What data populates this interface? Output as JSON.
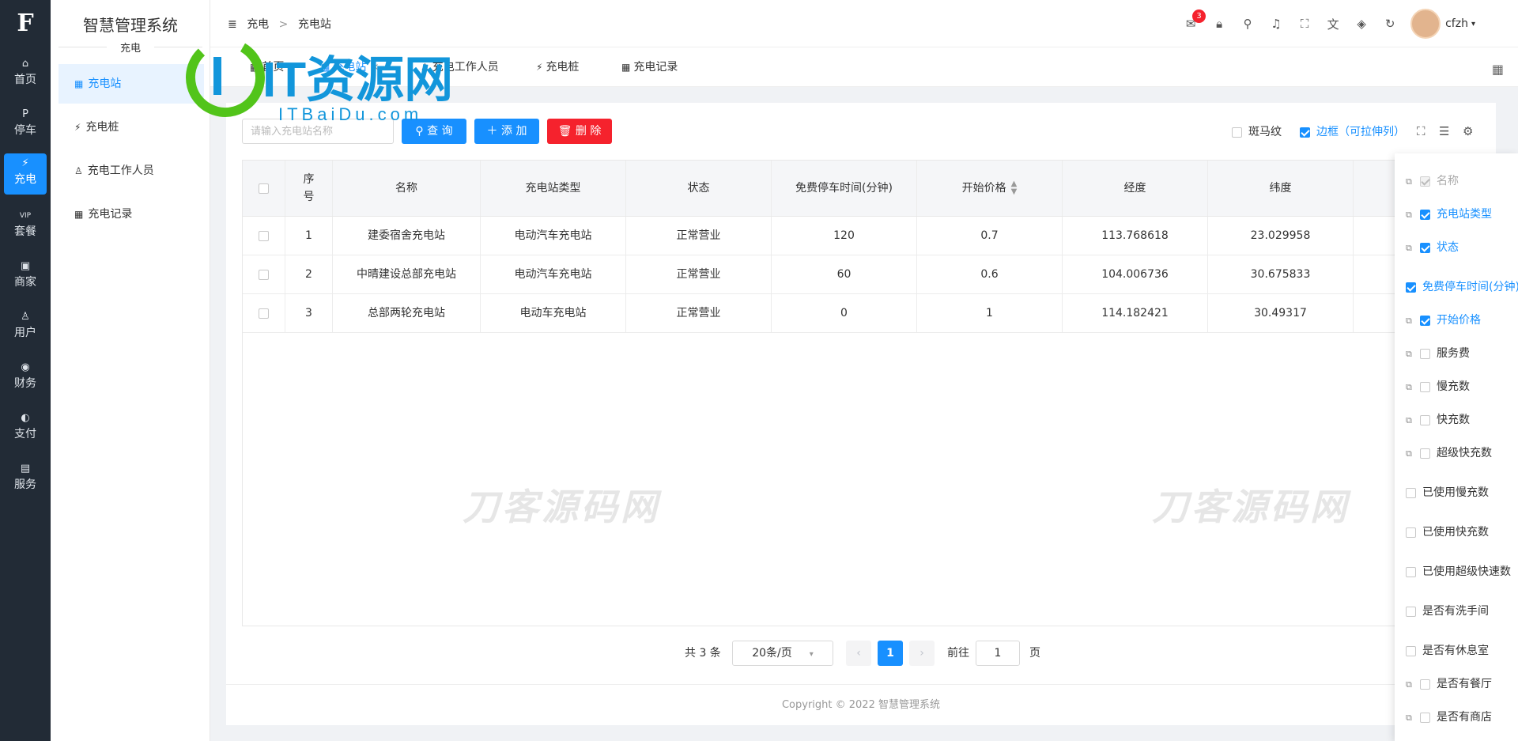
{
  "rail": {
    "logo": "F",
    "items": [
      {
        "label": "首页",
        "icon": "home-icon",
        "glyph": "⌂"
      },
      {
        "label": "停车",
        "icon": "parking-icon",
        "glyph": "P"
      },
      {
        "label": "充电",
        "icon": "charging-icon",
        "glyph": "⚡"
      },
      {
        "label": "套餐",
        "icon": "vip-icon",
        "glyph": "VIP"
      },
      {
        "label": "商家",
        "icon": "shop-icon",
        "glyph": "▣"
      },
      {
        "label": "用户",
        "icon": "user-icon",
        "glyph": "♙"
      },
      {
        "label": "财务",
        "icon": "finance-icon",
        "glyph": "◉"
      },
      {
        "label": "支付",
        "icon": "pay-icon",
        "glyph": "◐"
      },
      {
        "label": "服务",
        "icon": "service-icon",
        "glyph": "▤"
      }
    ]
  },
  "sidebar": {
    "title": "智慧管理系统",
    "section": "充电",
    "items": [
      {
        "label": "充电站",
        "icon": "station-icon",
        "glyph": "▦"
      },
      {
        "label": "充电桩",
        "icon": "pile-icon",
        "glyph": "⚡"
      },
      {
        "label": "充电工作人员",
        "icon": "staff-icon",
        "glyph": "♙"
      },
      {
        "label": "充电记录",
        "icon": "record-icon",
        "glyph": "▦"
      }
    ]
  },
  "header": {
    "collapse_icon": "≣",
    "breadcrumb": [
      "充电",
      ">",
      "充电站"
    ],
    "badge_count": "3",
    "username": "cfzh",
    "icons": [
      "message-icon",
      "lock-icon",
      "search-icon",
      "bell-icon",
      "fullscreen-icon",
      "translate-icon",
      "theme-icon",
      "refresh-icon"
    ]
  },
  "tabs": [
    {
      "label": "首页"
    },
    {
      "label": "充电站"
    },
    {
      "label": "充电工作人员"
    },
    {
      "label": "充电桩"
    },
    {
      "label": "充电记录"
    }
  ],
  "toolbar": {
    "search_placeholder": "请输入充电站名称",
    "query_label": "查 询",
    "add_label": "添 加",
    "delete_label": "删 除",
    "stripe_label": "斑马纹",
    "border_label": "边框（可拉伸列）"
  },
  "table": {
    "headers": [
      "序号",
      "名称",
      "充电站类型",
      "状态",
      "免费停车时间(分钟)",
      "开始价格",
      "经度",
      "纬度"
    ],
    "rows": [
      [
        "1",
        "建委宿舍充电站",
        "电动汽车充电站",
        "正常营业",
        "120",
        "0.7",
        "113.768618",
        "23.029958"
      ],
      [
        "2",
        "中晴建设总部充电站",
        "电动汽车充电站",
        "正常营业",
        "60",
        "0.6",
        "104.006736",
        "30.675833"
      ],
      [
        "3",
        "总部两轮充电站",
        "电动车充电站",
        "正常营业",
        "0",
        "1",
        "114.182421",
        "30.49317"
      ]
    ]
  },
  "watermark": "刀客源码网",
  "logo_overlay": {
    "main": "IT资源网",
    "sub": "ITBaiDu.com"
  },
  "pagination": {
    "total": "共 3 条",
    "page_size": "20条/页",
    "current": "1",
    "goto_label": "前往",
    "goto_value": "1",
    "page_suffix": "页"
  },
  "footer": "Copyright © 2022 智慧管理系统",
  "columns": [
    {
      "label": "名称",
      "state": "disabled"
    },
    {
      "label": "充电站类型",
      "state": "on"
    },
    {
      "label": "状态",
      "state": "on"
    },
    {
      "label": "免费停车时间(分钟)",
      "state": "on"
    },
    {
      "label": "开始价格",
      "state": "on"
    },
    {
      "label": "服务费",
      "state": "off"
    },
    {
      "label": "慢充数",
      "state": "off"
    },
    {
      "label": "快充数",
      "state": "off"
    },
    {
      "label": "超级快充数",
      "state": "off"
    },
    {
      "label": "已使用慢充数",
      "state": "off"
    },
    {
      "label": "已使用快充数",
      "state": "off"
    },
    {
      "label": "已使用超级快速数",
      "state": "off"
    },
    {
      "label": "是否有洗手间",
      "state": "off"
    },
    {
      "label": "是否有休息室",
      "state": "off"
    },
    {
      "label": "是否有餐厅",
      "state": "off"
    },
    {
      "label": "是否有商店",
      "state": "off"
    }
  ],
  "colors": {
    "primary": "#1890ff",
    "danger": "#f5222d",
    "rail": "#222b36",
    "logo_green": "#52c41a",
    "logo_blue": "#1296db"
  }
}
